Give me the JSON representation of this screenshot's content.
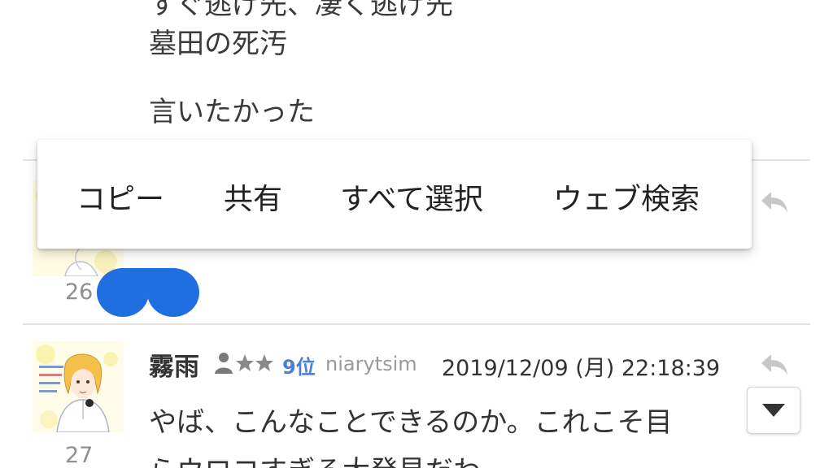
{
  "prev_comment": {
    "cut_line": "すぐ逃げ先、凄く逃げ先",
    "line_1": "墓田の死汚",
    "line_2": "言いたかった",
    "number": "26"
  },
  "context_menu": {
    "copy": "コピー",
    "share": "共有",
    "select_all": "すべて選択",
    "web_search": "ウェブ検索"
  },
  "comment": {
    "number": "27",
    "username": "霧雨",
    "rank": "9位",
    "user_id": "niarytsim",
    "timestamp": "2019/12/09 (月) 22:18:39",
    "body_line_1": "やば、こんなことできるのか。これこそ目",
    "body_line_2": "らウロコすぎる大発見だわ"
  },
  "colors": {
    "rank": "#4a7fd6",
    "redaction": "#1f6fe0",
    "reply_icon": "#c8c8c8"
  },
  "icons": {
    "reply": "reply-arrow-icon",
    "rank": "person-stars-icon",
    "scroll": "triangle-down-icon"
  }
}
